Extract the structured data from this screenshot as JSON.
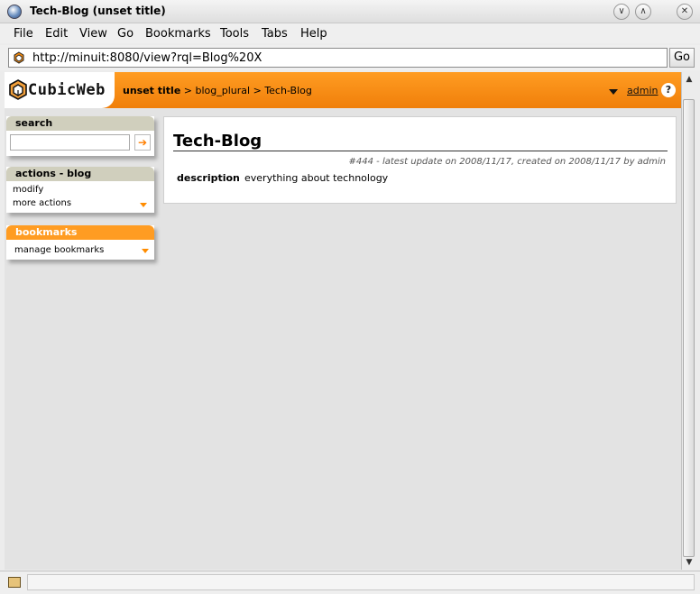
{
  "window": {
    "title": "Tech-Blog (unset title)"
  },
  "menubar": {
    "items": [
      {
        "label": "File"
      },
      {
        "label": "Edit"
      },
      {
        "label": "View"
      },
      {
        "label": "Go"
      },
      {
        "label": "Bookmarks"
      },
      {
        "label": "Tools"
      },
      {
        "label": "Tabs"
      },
      {
        "label": "Help"
      }
    ]
  },
  "address": {
    "url": "http://minuit:8080/view?rql=Blog%20X",
    "go_label": "Go"
  },
  "header": {
    "logo_text": "CubicWeb",
    "breadcrumb": {
      "first": "unset title",
      "sep": " > ",
      "second": "blog_plural",
      "third": "Tech-Blog"
    },
    "user": "admin",
    "help": "?"
  },
  "sidebar": {
    "search_title": "search",
    "search_button": "➔",
    "actions_title": "actions - blog",
    "actions": [
      {
        "label": "modify"
      },
      {
        "label": "more actions"
      }
    ],
    "bookmarks_title": "bookmarks",
    "bookmarks_item": "manage bookmarks"
  },
  "main": {
    "title": "Tech-Blog",
    "meta": "#444 - latest update on 2008/11/17, created on 2008/11/17 by admin",
    "description_label": "description",
    "description_value": "everything about technology"
  },
  "colors": {
    "accent": "#f07f0a",
    "box_header": "#d0cfbd"
  }
}
